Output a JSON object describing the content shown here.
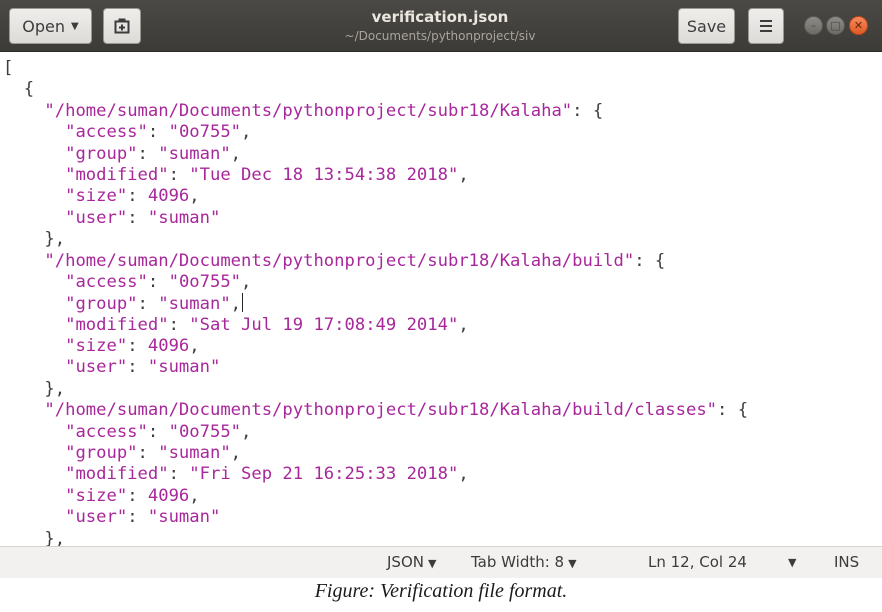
{
  "header": {
    "open_label": "Open",
    "title": "verification.json",
    "subtitle": "~/Documents/pythonproject/siv",
    "save_label": "Save"
  },
  "editor": {
    "lines": [
      [
        {
          "t": "[",
          "c": "p"
        }
      ],
      [
        {
          "t": "  {",
          "c": "p"
        }
      ],
      [
        {
          "t": "    ",
          "c": "p"
        },
        {
          "t": "\"/home/suman/Documents/pythonproject/subr18/Kalaha\"",
          "c": "key"
        },
        {
          "t": ": {",
          "c": "p"
        }
      ],
      [
        {
          "t": "      ",
          "c": "p"
        },
        {
          "t": "\"access\"",
          "c": "key"
        },
        {
          "t": ": ",
          "c": "p"
        },
        {
          "t": "\"0o755\"",
          "c": "str"
        },
        {
          "t": ",",
          "c": "p"
        }
      ],
      [
        {
          "t": "      ",
          "c": "p"
        },
        {
          "t": "\"group\"",
          "c": "key"
        },
        {
          "t": ": ",
          "c": "p"
        },
        {
          "t": "\"suman\"",
          "c": "str"
        },
        {
          "t": ",",
          "c": "p"
        }
      ],
      [
        {
          "t": "      ",
          "c": "p"
        },
        {
          "t": "\"modified\"",
          "c": "key"
        },
        {
          "t": ": ",
          "c": "p"
        },
        {
          "t": "\"Tue Dec 18 13:54:38 2018\"",
          "c": "str"
        },
        {
          "t": ",",
          "c": "p"
        }
      ],
      [
        {
          "t": "      ",
          "c": "p"
        },
        {
          "t": "\"size\"",
          "c": "key"
        },
        {
          "t": ": ",
          "c": "p"
        },
        {
          "t": "4096",
          "c": "num"
        },
        {
          "t": ",",
          "c": "p"
        }
      ],
      [
        {
          "t": "      ",
          "c": "p"
        },
        {
          "t": "\"user\"",
          "c": "key"
        },
        {
          "t": ": ",
          "c": "p"
        },
        {
          "t": "\"suman\"",
          "c": "str"
        }
      ],
      [
        {
          "t": "    },",
          "c": "p"
        }
      ],
      [
        {
          "t": "    ",
          "c": "p"
        },
        {
          "t": "\"/home/suman/Documents/pythonproject/subr18/Kalaha/build\"",
          "c": "key"
        },
        {
          "t": ": {",
          "c": "p"
        }
      ],
      [
        {
          "t": "      ",
          "c": "p"
        },
        {
          "t": "\"access\"",
          "c": "key"
        },
        {
          "t": ": ",
          "c": "p"
        },
        {
          "t": "\"0o755\"",
          "c": "str"
        },
        {
          "t": ",",
          "c": "p"
        }
      ],
      [
        {
          "t": "      ",
          "c": "p"
        },
        {
          "t": "\"group\"",
          "c": "key"
        },
        {
          "t": ": ",
          "c": "p"
        },
        {
          "t": "\"suman\"",
          "c": "str"
        },
        {
          "t": ",",
          "c": "p"
        },
        {
          "t": "",
          "c": "cursor"
        }
      ],
      [
        {
          "t": "      ",
          "c": "p"
        },
        {
          "t": "\"modified\"",
          "c": "key"
        },
        {
          "t": ": ",
          "c": "p"
        },
        {
          "t": "\"Sat Jul 19 17:08:49 2014\"",
          "c": "str"
        },
        {
          "t": ",",
          "c": "p"
        }
      ],
      [
        {
          "t": "      ",
          "c": "p"
        },
        {
          "t": "\"size\"",
          "c": "key"
        },
        {
          "t": ": ",
          "c": "p"
        },
        {
          "t": "4096",
          "c": "num"
        },
        {
          "t": ",",
          "c": "p"
        }
      ],
      [
        {
          "t": "      ",
          "c": "p"
        },
        {
          "t": "\"user\"",
          "c": "key"
        },
        {
          "t": ": ",
          "c": "p"
        },
        {
          "t": "\"suman\"",
          "c": "str"
        }
      ],
      [
        {
          "t": "    },",
          "c": "p"
        }
      ],
      [
        {
          "t": "    ",
          "c": "p"
        },
        {
          "t": "\"/home/suman/Documents/pythonproject/subr18/Kalaha/build/classes\"",
          "c": "key"
        },
        {
          "t": ": {",
          "c": "p"
        }
      ],
      [
        {
          "t": "      ",
          "c": "p"
        },
        {
          "t": "\"access\"",
          "c": "key"
        },
        {
          "t": ": ",
          "c": "p"
        },
        {
          "t": "\"0o755\"",
          "c": "str"
        },
        {
          "t": ",",
          "c": "p"
        }
      ],
      [
        {
          "t": "      ",
          "c": "p"
        },
        {
          "t": "\"group\"",
          "c": "key"
        },
        {
          "t": ": ",
          "c": "p"
        },
        {
          "t": "\"suman\"",
          "c": "str"
        },
        {
          "t": ",",
          "c": "p"
        }
      ],
      [
        {
          "t": "      ",
          "c": "p"
        },
        {
          "t": "\"modified\"",
          "c": "key"
        },
        {
          "t": ": ",
          "c": "p"
        },
        {
          "t": "\"Fri Sep 21 16:25:33 2018\"",
          "c": "str"
        },
        {
          "t": ",",
          "c": "p"
        }
      ],
      [
        {
          "t": "      ",
          "c": "p"
        },
        {
          "t": "\"size\"",
          "c": "key"
        },
        {
          "t": ": ",
          "c": "p"
        },
        {
          "t": "4096",
          "c": "num"
        },
        {
          "t": ",",
          "c": "p"
        }
      ],
      [
        {
          "t": "      ",
          "c": "p"
        },
        {
          "t": "\"user\"",
          "c": "key"
        },
        {
          "t": ": ",
          "c": "p"
        },
        {
          "t": "\"suman\"",
          "c": "str"
        }
      ],
      [
        {
          "t": "    },",
          "c": "p"
        }
      ]
    ]
  },
  "statusbar": {
    "language": "JSON",
    "tab_width": "Tab Width: 8",
    "position": "Ln 12, Col 24",
    "insert_mode": "INS"
  },
  "caption": "Figure: Verification file format."
}
